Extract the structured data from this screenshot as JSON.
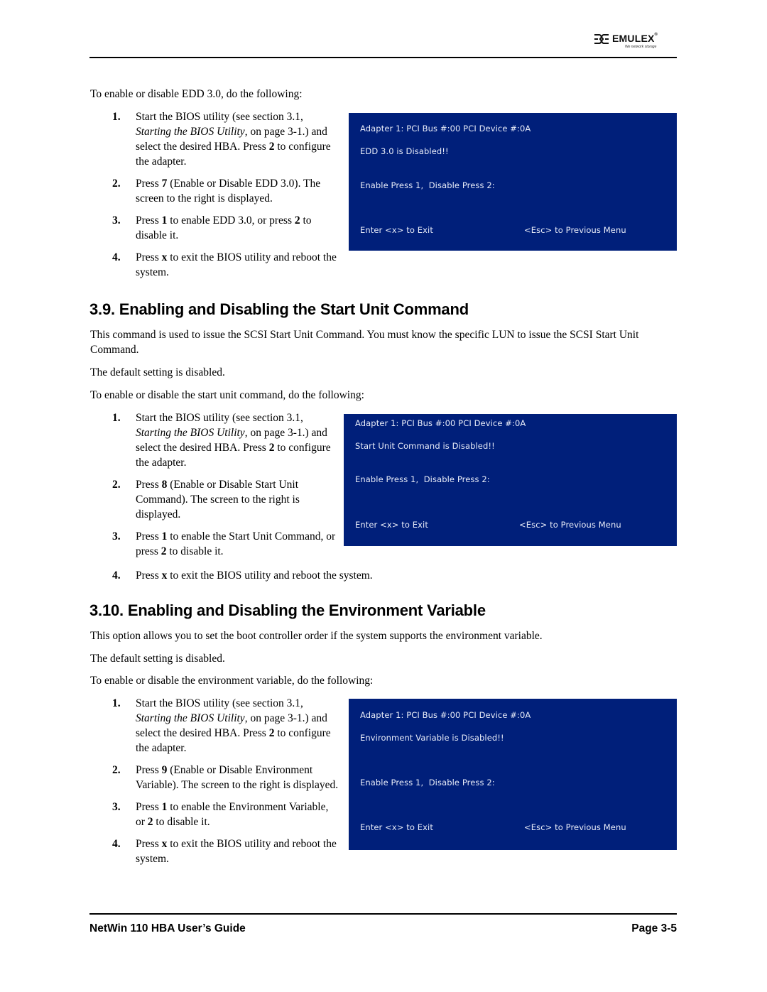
{
  "header": {
    "logo_text": "EMULEX",
    "logo_tagline": "We network storage",
    "logo_icon": "emulex-logo-icon"
  },
  "footer": {
    "title": "NetWin 110 HBA User’s Guide",
    "page": "Page 3-5"
  },
  "edd": {
    "intro": "To enable or disable EDD 3.0, do the following:",
    "steps": [
      {
        "num": "1.",
        "parts": [
          {
            "t": "Start the BIOS utility (see section 3.1, "
          },
          {
            "t": "Starting the BIOS Utility",
            "i": true
          },
          {
            "t": ", on page 3-1.) and select the desired HBA. Press "
          },
          {
            "t": "2",
            "b": true
          },
          {
            "t": " to configure the adapter."
          }
        ]
      },
      {
        "num": "2.",
        "parts": [
          {
            "t": "Press "
          },
          {
            "t": "7",
            "b": true
          },
          {
            "t": " (Enable or Disable EDD 3.0). The screen to the right is displayed."
          }
        ]
      },
      {
        "num": "3.",
        "parts": [
          {
            "t": "Press "
          },
          {
            "t": "1",
            "b": true
          },
          {
            "t": " to enable EDD 3.0, or press "
          },
          {
            "t": "2",
            "b": true
          },
          {
            "t": " to disable it."
          }
        ]
      },
      {
        "num": "4.",
        "parts": [
          {
            "t": "Press "
          },
          {
            "t": "x",
            "b": true
          },
          {
            "t": " to exit the BIOS utility and reboot the system."
          }
        ]
      }
    ],
    "screen": {
      "adapter": "Adapter 1: PCI Bus #:00 PCI Device #:0A",
      "status": "EDD 3.0 is Disabled!!",
      "prompt": "Enable Press 1,  Disable Press 2:",
      "exit": "Enter <x> to Exit",
      "prev": "<Esc> to Previous Menu"
    }
  },
  "start_unit": {
    "heading": "3.9. Enabling and Disabling the Start Unit Command",
    "desc": "This command is used to issue the SCSI Start Unit Command. You must know the specific LUN to issue the SCSI Start Unit Command.",
    "default": "The default setting is disabled.",
    "intro": "To enable or disable the start unit command, do the following:",
    "steps": [
      {
        "num": "1.",
        "parts": [
          {
            "t": "Start the BIOS utility (see section 3.1, "
          },
          {
            "t": "Starting the BIOS Utility",
            "i": true
          },
          {
            "t": ", on page 3-1.) and select the desired HBA. Press "
          },
          {
            "t": "2",
            "b": true
          },
          {
            "t": " to configure the adapter."
          }
        ]
      },
      {
        "num": "2.",
        "parts": [
          {
            "t": "Press "
          },
          {
            "t": "8",
            "b": true
          },
          {
            "t": " (Enable or Disable Start Unit Command). The screen to the right is displayed."
          }
        ]
      },
      {
        "num": "3.",
        "parts": [
          {
            "t": "Press "
          },
          {
            "t": "1",
            "b": true
          },
          {
            "t": " to enable the Start Unit Command, or press "
          },
          {
            "t": "2",
            "b": true
          },
          {
            "t": " to disable it."
          }
        ]
      }
    ],
    "step4": {
      "num": "4.",
      "parts": [
        {
          "t": "Press "
        },
        {
          "t": "x",
          "b": true
        },
        {
          "t": " to exit the BIOS utility and reboot the system."
        }
      ]
    },
    "screen": {
      "adapter": "Adapter 1: PCI Bus #:00 PCI Device #:0A",
      "status": "Start Unit Command is Disabled!!",
      "prompt": "Enable Press 1,  Disable Press 2:",
      "exit": "Enter <x> to Exit",
      "prev": "<Esc> to Previous Menu"
    }
  },
  "env_var": {
    "heading": "3.10. Enabling and Disabling the Environment Variable",
    "desc": "This option allows you to set the boot controller order if the system supports the environment variable.",
    "default": "The default setting is disabled.",
    "intro": "To enable or disable the environment variable, do the following:",
    "steps": [
      {
        "num": "1.",
        "parts": [
          {
            "t": "Start the BIOS utility (see section 3.1, "
          },
          {
            "t": "Starting the BIOS Utility",
            "i": true
          },
          {
            "t": ", on page 3-1.) and select the desired HBA. Press "
          },
          {
            "t": "2",
            "b": true
          },
          {
            "t": " to configure the adapter."
          }
        ]
      },
      {
        "num": "2.",
        "parts": [
          {
            "t": "Press "
          },
          {
            "t": "9",
            "b": true
          },
          {
            "t": " (Enable or Disable Environment Variable). The screen to the right is displayed."
          }
        ]
      },
      {
        "num": "3.",
        "parts": [
          {
            "t": "Press "
          },
          {
            "t": "1",
            "b": true
          },
          {
            "t": " to enable the Environment Variable, or "
          },
          {
            "t": "2",
            "b": true
          },
          {
            "t": " to disable it."
          }
        ]
      },
      {
        "num": "4.",
        "parts": [
          {
            "t": "Press "
          },
          {
            "t": "x",
            "b": true
          },
          {
            "t": " to exit the BIOS utility and reboot the system."
          }
        ]
      }
    ],
    "screen": {
      "adapter": "Adapter 1: PCI Bus #:00 PCI Device #:0A",
      "status": "Environment Variable is Disabled!!",
      "prompt": "Enable Press 1,  Disable Press 2:",
      "exit": "Enter <x> to Exit",
      "prev": "<Esc> to Previous Menu"
    }
  },
  "colors": {
    "bios_bg": "#001f7a",
    "bios_text": "#e8ecf8"
  }
}
